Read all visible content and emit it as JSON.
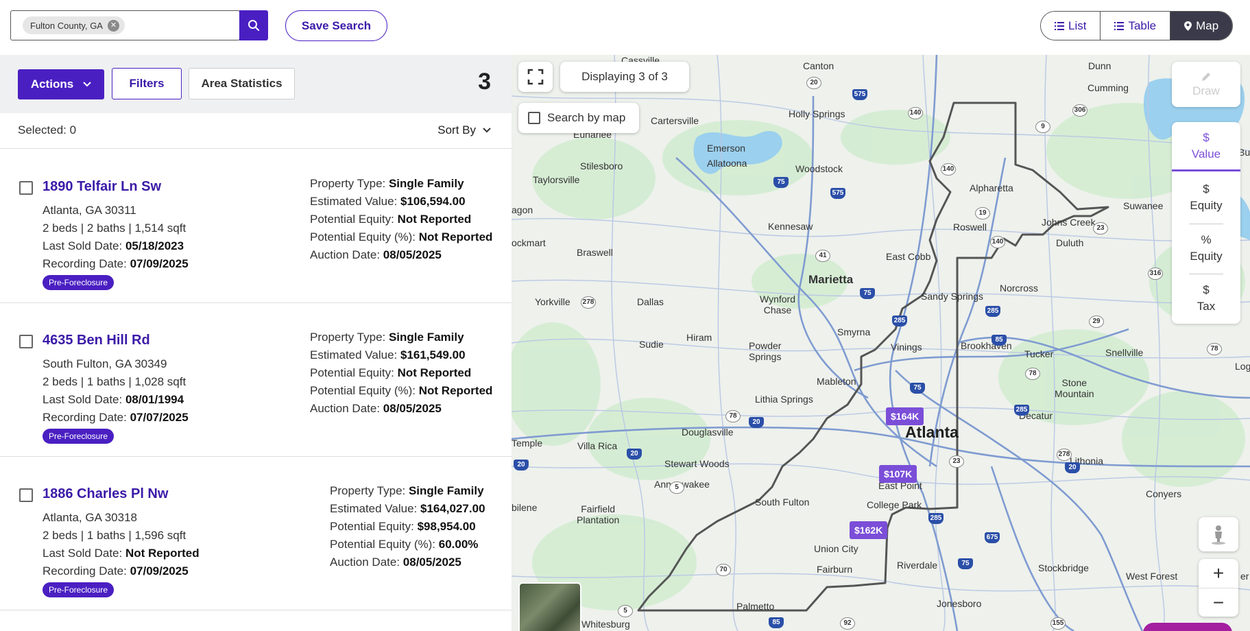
{
  "search": {
    "chip_label": "Fulton County, GA",
    "save_label": "Save Search"
  },
  "views": {
    "list": "List",
    "table": "Table",
    "map": "Map",
    "active": "Map"
  },
  "toolbar": {
    "actions": "Actions",
    "filters": "Filters",
    "area_stats": "Area Statistics",
    "count": "3"
  },
  "selection": {
    "selected": "Selected: 0",
    "sort": "Sort By"
  },
  "listings": [
    {
      "address": "1890 Telfair Ln Sw",
      "city": "Atlanta, GA 30311",
      "specs": "2 beds | 2 baths | 1,514 sqft",
      "last_sold_label": "Last Sold Date: ",
      "last_sold": "05/18/2023",
      "recording_label": "Recording Date: ",
      "recording": "07/09/2025",
      "tag": "Pre-Foreclosure",
      "ptype_label": "Property Type: ",
      "ptype": "Single Family",
      "value_label": "Estimated Value: ",
      "value": "$106,594.00",
      "equity_label": "Potential Equity: ",
      "equity": "Not Reported",
      "equity_pct_label": "Potential Equity (%): ",
      "equity_pct": "Not Reported",
      "auction_label": "Auction Date: ",
      "auction": "08/05/2025"
    },
    {
      "address": "4635 Ben Hill Rd",
      "city": "South Fulton, GA 30349",
      "specs": "2 beds | 1 baths | 1,028 sqft",
      "last_sold_label": "Last Sold Date: ",
      "last_sold": "08/01/1994",
      "recording_label": "Recording Date: ",
      "recording": "07/07/2025",
      "tag": "Pre-Foreclosure",
      "ptype_label": "Property Type: ",
      "ptype": "Single Family",
      "value_label": "Estimated Value: ",
      "value": "$161,549.00",
      "equity_label": "Potential Equity: ",
      "equity": "Not Reported",
      "equity_pct_label": "Potential Equity (%): ",
      "equity_pct": "Not Reported",
      "auction_label": "Auction Date: ",
      "auction": "08/05/2025"
    },
    {
      "address": "1886 Charles Pl Nw",
      "city": "Atlanta, GA 30318",
      "specs": "2 beds | 1 baths | 1,596 sqft",
      "last_sold_label": "Last Sold Date: ",
      "last_sold": "Not Reported",
      "recording_label": "Recording Date: ",
      "recording": "07/09/2025",
      "tag": "Pre-Foreclosure",
      "ptype_label": "Property Type: ",
      "ptype": "Single Family",
      "value_label": "Estimated Value: ",
      "value": "$164,027.00",
      "equity_label": "Potential Equity: ",
      "equity": "$98,954.00",
      "equity_pct_label": "Potential Equity (%): ",
      "equity_pct": "60.00%",
      "auction_label": "Auction Date: ",
      "auction": "08/05/2025"
    }
  ],
  "map": {
    "displaying": "Displaying 3 of 3",
    "search_by_map": "Search by map",
    "draw": "Draw",
    "layers": [
      {
        "symbol": "$",
        "label": "Value"
      },
      {
        "symbol": "$",
        "label": "Equity"
      },
      {
        "symbol": "%",
        "label": "Equity"
      },
      {
        "symbol": "$",
        "label": "Tax"
      }
    ],
    "zoom_in": "+",
    "zoom_out": "−",
    "markers": [
      "$164K",
      "$107K",
      "$162K"
    ],
    "places": {
      "atlanta": "Atlanta",
      "marietta": "Marietta",
      "cassville": "Cassville",
      "canton": "Canton",
      "dunn": "Dunn",
      "cumming": "Cumming",
      "holly_springs": "Holly Springs",
      "cartersville": "Cartersville",
      "euharlee": "Euharlee",
      "emerson": "Emerson",
      "stilesboro": "Stilesboro",
      "allatoona": "Allatoona",
      "woodstock": "Woodstock",
      "taylorsville": "Taylorsville",
      "alpharetta": "Alpharetta",
      "suwanee": "Suwanee",
      "bufo": "Buf",
      "aragon": "agon",
      "kennesaw": "Kennesaw",
      "roswell": "Roswell",
      "johns_creek": "Johns Creek",
      "duluth": "Duluth",
      "rockmart": "ockmart",
      "braswell": "Braswell",
      "east_cobb": "East Cobb",
      "norcross": "Norcross",
      "yorkville": "Yorkville",
      "dallas": "Dallas",
      "wynford_chase": "Wynford\nChase",
      "sandy_springs": "Sandy Springs",
      "smyrna": "Smyrna",
      "vinings": "Vinings",
      "brookhaven": "Brookhaven",
      "tucker": "Tucker",
      "snellville": "Snellville",
      "sudie": "Sudie",
      "hiram": "Hiram",
      "powder_springs": "Powder\nSprings",
      "mableton": "Mableton",
      "stone_mountain": "Stone\nMountain",
      "loganville": "Loganv",
      "lithia_springs": "Lithia Springs",
      "douglasville": "Douglasville",
      "decatur": "Decatur",
      "temple": "Temple",
      "villa_rica": "Villa Rica",
      "stewart_woods": "Stewart Woods",
      "east_point": "East Point",
      "lithonia": "Lithonia",
      "anneewakee": "Anneewakee",
      "conyers": "Conyers",
      "bilene": "bilene",
      "fairfield_plantation": "Fairfield\nPlantation",
      "south_fulton": "South Fulton",
      "college_park": "College Park",
      "union_city": "Union City",
      "riverdale": "Riverdale",
      "fairburn": "Fairburn",
      "stockbridge": "Stockbridge",
      "west_forest": "West Forest",
      "palmetto": "Palmetto",
      "jonesboro": "Jonesboro",
      "whitesburg": "Whitesburg",
      "oxford": "er"
    }
  },
  "colors": {
    "brand": "#4a1fc2",
    "marker": "#7b4ed8",
    "link": "#3b1aa8"
  }
}
